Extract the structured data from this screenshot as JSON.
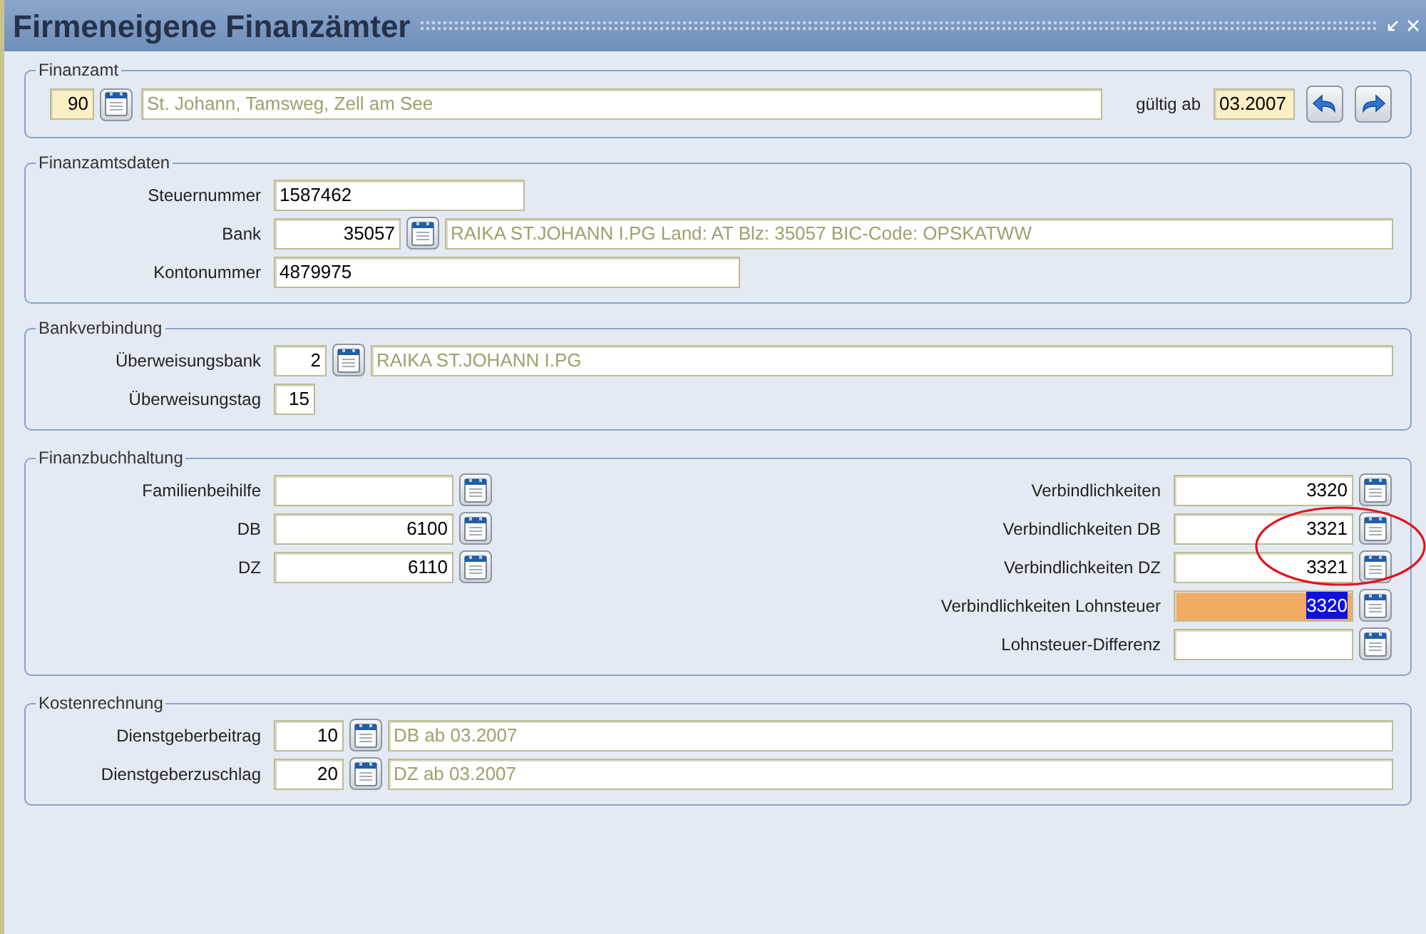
{
  "window": {
    "title": "Firmeneigene Finanzämter"
  },
  "finanzamt": {
    "legend": "Finanzamt",
    "code": {
      "value": "90",
      "kind": "required-number"
    },
    "name": {
      "value": "St. Johann, Tamsweg, Zell am See",
      "kind": "description"
    },
    "valid_label": "gültig ab",
    "valid_from": {
      "value": "03.2007",
      "kind": "required-text"
    }
  },
  "finanzamtsdaten": {
    "legend": "Finanzamtsdaten",
    "rows": [
      {
        "label": "Steuernummer",
        "field": {
          "value": "1587462",
          "kind": "text"
        }
      },
      {
        "label": "Bank",
        "field": {
          "value": "35057",
          "kind": "number"
        },
        "description": {
          "value": "RAIKA ST.JOHANN I.PG Land: AT Blz: 35057 BIC-Code: OPSKATWW",
          "kind": "description"
        }
      },
      {
        "label": "Kontonummer",
        "field": {
          "value": "4879975",
          "kind": "text"
        }
      }
    ]
  },
  "bankverbindung": {
    "legend": "Bankverbindung",
    "rows": [
      {
        "label": "Überweisungsbank",
        "field": {
          "value": "2",
          "kind": "number"
        },
        "description": {
          "value": "RAIKA ST.JOHANN I.PG",
          "kind": "description"
        }
      },
      {
        "label": "Überweisungstag",
        "field": {
          "value": "15",
          "kind": "number"
        }
      }
    ]
  },
  "finanzbuchhaltung": {
    "legend": "Finanzbuchhaltung",
    "left_rows": [
      {
        "label": "Familienbeihilfe",
        "field": {
          "kind": "number",
          "focused": false
        }
      },
      {
        "label": "DB",
        "field": {
          "value": "6100",
          "kind": "number",
          "focused": false
        }
      },
      {
        "label": "DZ",
        "field": {
          "value": "6110",
          "kind": "number",
          "focused": false
        }
      }
    ],
    "right_rows": [
      {
        "label": "Verbindlichkeiten",
        "field": {
          "value": "3320",
          "kind": "number",
          "focused": false
        }
      },
      {
        "label": "Verbindlichkeiten DB",
        "field": {
          "value": "3321",
          "kind": "number",
          "focused": false
        }
      },
      {
        "label": "Verbindlichkeiten DZ",
        "field": {
          "value": "3321",
          "kind": "number",
          "focused": false
        }
      },
      {
        "label": "Verbindlichkeiten Lohnsteuer",
        "field": {
          "value": "3320",
          "kind": "number",
          "focused": true
        }
      },
      {
        "label": "Lohnsteuer-Differenz",
        "field": {
          "kind": "number",
          "focused": false
        }
      }
    ],
    "annotation": {
      "kind": "ellipse"
    }
  },
  "kostenrechnung": {
    "legend": "Kostenrechnung",
    "rows": [
      {
        "label": "Dienstgeberbeitrag",
        "field": {
          "value": "10",
          "kind": "number"
        },
        "description": {
          "value": "DB ab 03.2007",
          "kind": "description"
        }
      },
      {
        "label": "Dienstgeberzuschlag",
        "field": {
          "value": "20",
          "kind": "number"
        },
        "description": {
          "value": "DZ ab 03.2007",
          "kind": "description"
        }
      }
    ]
  }
}
